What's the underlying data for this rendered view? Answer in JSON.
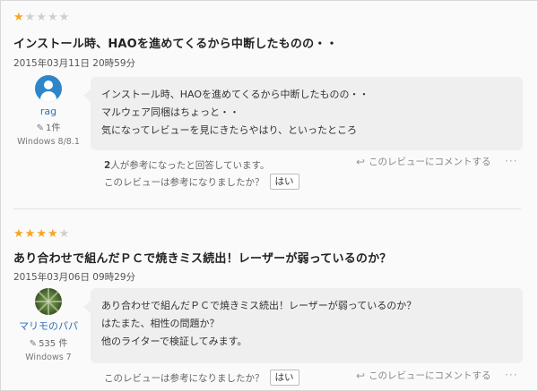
{
  "reviews": [
    {
      "rating": 1,
      "max_rating": 5,
      "title": "インストール時、HAOを進めてくるから中断したものの・・",
      "date": "2015年03月11日 20時59分",
      "user": {
        "name": "rag",
        "review_count": "1件",
        "os": "Windows 8/8.1"
      },
      "body": [
        "インストール時、HAOを進めてくるから中断したものの・・",
        "マルウェア同梱はちょっと・・",
        "気になってレビューを見にきたらやはり、といったところ"
      ],
      "helpful_count": "2",
      "helpful_text": "人が参考になったと回答しています。",
      "ask_text": "このレビューは参考になりましたか？",
      "yes_label": "はい",
      "comment_label": "このレビューにコメントする",
      "more_label": "···"
    },
    {
      "rating": 4,
      "max_rating": 5,
      "title": "あり合わせで組んだＰＣで焼きミス続出！レーザーが弱っているのか？",
      "date": "2015年03月06日 09時29分",
      "user": {
        "name": "マリモのパパ",
        "review_count": "535 件",
        "os": "Windows 7"
      },
      "body": [
        "あり合わせで組んだＰＣで焼きミス続出！レーザーが弱っているのか？",
        "はたまた、相性の問題か？",
        "他のライターで検証してみます。"
      ],
      "ask_text": "このレビューは参考になりましたか？",
      "yes_label": "はい",
      "comment_label": "このレビューにコメントする",
      "more_label": "···"
    }
  ],
  "colors": {
    "star_on": "#f5a623",
    "star_off": "#cfcfcf",
    "username": "#2d6fb5",
    "bubble": "#efefef"
  }
}
